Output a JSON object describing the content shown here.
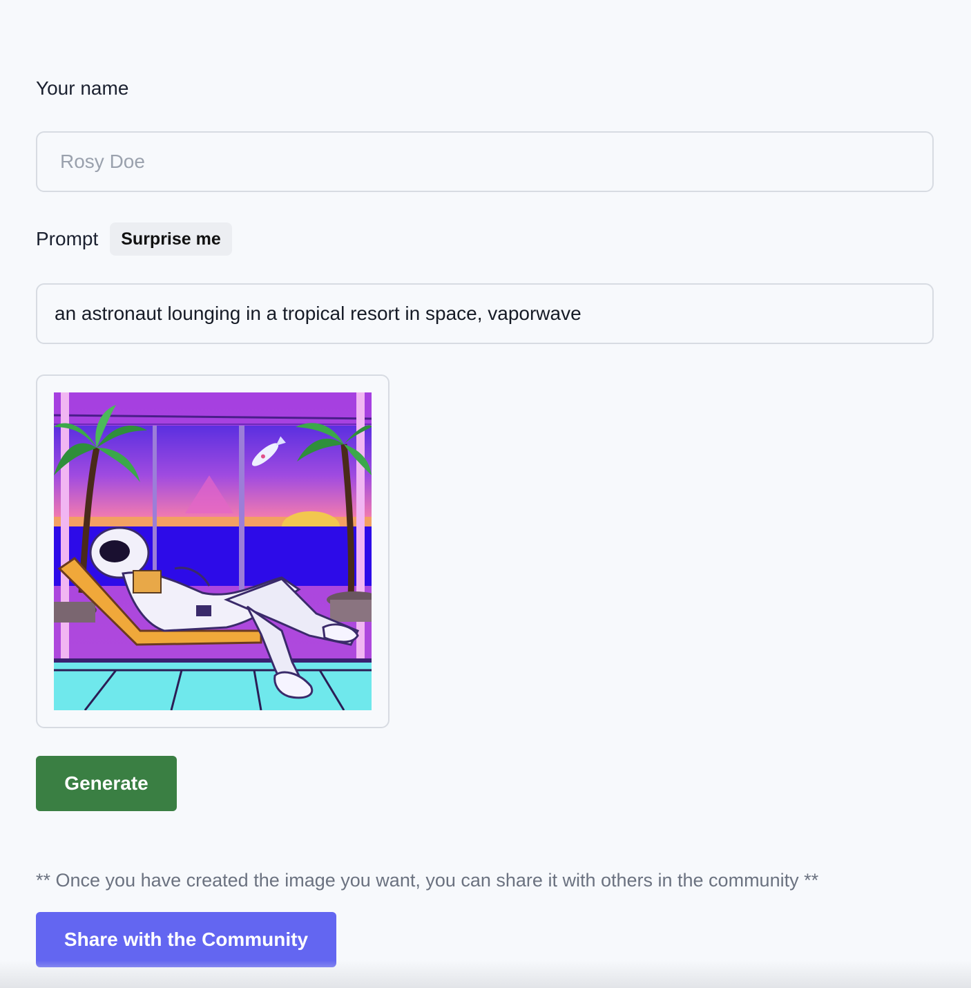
{
  "form": {
    "name_label": "Your name",
    "name_placeholder": "Rosy Doe",
    "name_value": "",
    "prompt_label": "Prompt",
    "surprise_label": "Surprise me",
    "prompt_value": "an astronaut lounging in a tropical resort in space, vaporwave"
  },
  "preview": {
    "image_subject": "astronaut-lounging-vaporwave-illustration"
  },
  "actions": {
    "generate_label": "Generate",
    "share_note": "** Once you have created the image you want, you can share it with others in the community **",
    "share_label": "Share with the Community"
  },
  "colors": {
    "background": "#f7f9fc",
    "generate": "#3a7f43",
    "share": "#6366f1",
    "border": "#d7dbe2"
  }
}
